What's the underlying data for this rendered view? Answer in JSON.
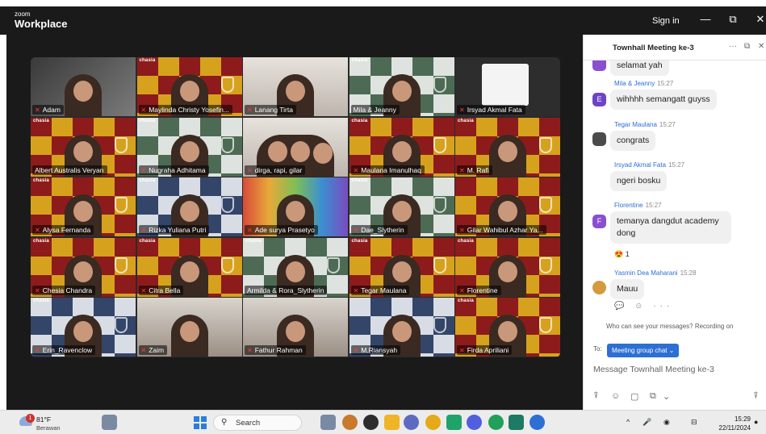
{
  "app": {
    "brand_small": "zoom",
    "brand_large": "Workplace",
    "sign_in": "Sign in"
  },
  "window_controls": {
    "minimize": "—",
    "restore": "⧉",
    "close": "✕"
  },
  "participants": [
    {
      "name": "Adam",
      "house": "",
      "bg": "dark",
      "muted": true
    },
    {
      "name": "Maylinda Christy Yosefin...",
      "house": "chasia",
      "bg": "gryf",
      "muted": true
    },
    {
      "name": "Lanang Tirta",
      "house": "",
      "bg": "light",
      "muted": true
    },
    {
      "name": "Mila & Jeanny",
      "house": "chasia",
      "bg": "slyth",
      "muted": false,
      "active": true
    },
    {
      "name": "Irsyad Akmal Fata",
      "house": "",
      "bg": "white",
      "muted": true
    },
    {
      "name": "Albert Australis Veryan",
      "house": "chasia",
      "bg": "gryf",
      "muted": false
    },
    {
      "name": "Nugraha Adhitama",
      "house": "chasia",
      "bg": "slyth",
      "muted": true
    },
    {
      "name": "dirga, rapi, gilar",
      "house": "",
      "bg": "light",
      "muted": true,
      "group": true
    },
    {
      "name": "Maulana Imanulhaq",
      "house": "chasia",
      "bg": "gryf",
      "muted": true
    },
    {
      "name": "M. Rafi",
      "house": "chasia",
      "bg": "gryf",
      "muted": true
    },
    {
      "name": "Alysa Fernanda",
      "house": "chasia",
      "bg": "gryf",
      "muted": true
    },
    {
      "name": "Rizka Yuliana Putri",
      "house": "chasia",
      "bg": "raven",
      "muted": true
    },
    {
      "name": "Ade surya Prasetyo",
      "house": "",
      "bg": "colorful",
      "muted": true
    },
    {
      "name": "Dae_Slytherin",
      "house": "chasia",
      "bg": "slyth",
      "muted": true
    },
    {
      "name": "Gilar Wahibul Azhar Ya...",
      "house": "",
      "bg": "gryf",
      "muted": true
    },
    {
      "name": "Chesia Chandra",
      "house": "chasia",
      "bg": "gryf",
      "muted": true
    },
    {
      "name": "Citra Bella",
      "house": "chasia",
      "bg": "gryf",
      "muted": true
    },
    {
      "name": "Armilda & Rora_Slytherin",
      "house": "chasia",
      "bg": "slyth",
      "muted": false
    },
    {
      "name": "Tegar Maulana",
      "house": "chasia",
      "bg": "gryf",
      "muted": true
    },
    {
      "name": "Florentine",
      "house": "chasia",
      "bg": "gryf",
      "muted": true
    },
    {
      "name": "Erin_Ravenclow",
      "house": "chasia",
      "bg": "raven",
      "muted": true
    },
    {
      "name": "Zaim",
      "house": "",
      "bg": "room",
      "muted": true
    },
    {
      "name": "Fathur Rahman",
      "house": "",
      "bg": "room",
      "muted": true
    },
    {
      "name": "M.Riansyah",
      "house": "",
      "bg": "raven",
      "muted": true
    },
    {
      "name": "Firda Apriliani",
      "house": "chasia",
      "bg": "gryf",
      "muted": true
    }
  ],
  "chat": {
    "title": "Townhall Meeting ke-3",
    "header_icons": [
      "···",
      "⧉",
      "✕"
    ],
    "partial_message": "selamat yah",
    "messages": [
      {
        "sender": "Mila & Jeanny",
        "time": "15:27",
        "text": "wihhhh semangatt guyss",
        "avatar_letter": "E",
        "avatar_color": "#6e44c7"
      },
      {
        "sender": "Tegar Maulana",
        "time": "15:27",
        "text": "congrats",
        "avatar_letter": "",
        "avatar_color": "#4b4b4b"
      },
      {
        "sender": "Irsyad Akmal Fata",
        "time": "15:27",
        "text": "ngeri bosku",
        "avatar_letter": "",
        "avatar_color": ""
      },
      {
        "sender": "Florentine",
        "time": "15:27",
        "text": "temanya dangdut academy dong",
        "avatar_letter": "F",
        "avatar_color": "#8a4fd0",
        "reaction": "😍 1"
      },
      {
        "sender": "Yasmin Dea Maharani",
        "time": "15:28",
        "text": "Mauu",
        "avatar_letter": "",
        "avatar_color": "#d39a3f"
      }
    ],
    "message_tools": "💬 ☺ ···",
    "privacy_notice": "Who can see your messages? Recording on",
    "to_label": "To:",
    "recipient": "Meeting group chat ⌄",
    "input_placeholder": "Message Townhall Meeting ke-3",
    "toolbar_icons": [
      "⍒",
      "☺",
      "▢",
      "⧉",
      "⌄",
      "⍒"
    ]
  },
  "taskbar": {
    "weather_badge": "1",
    "temperature": "81°F",
    "weather_desc": "Berawan",
    "search_label": "Search",
    "clock_time": "15:29",
    "clock_date": "22/11/2024",
    "tray_icons": [
      "^",
      "🎤",
      "◉",
      "⊟"
    ],
    "app_colors": [
      "#7a8aa3",
      "#c87a2a",
      "#2d2d2d",
      "#f0b429",
      "#5c6bc0",
      "#e6a917",
      "#20a36b",
      "#4f5fe0",
      "#21a05a",
      "#1d7a64",
      "#2d6fd4"
    ]
  }
}
